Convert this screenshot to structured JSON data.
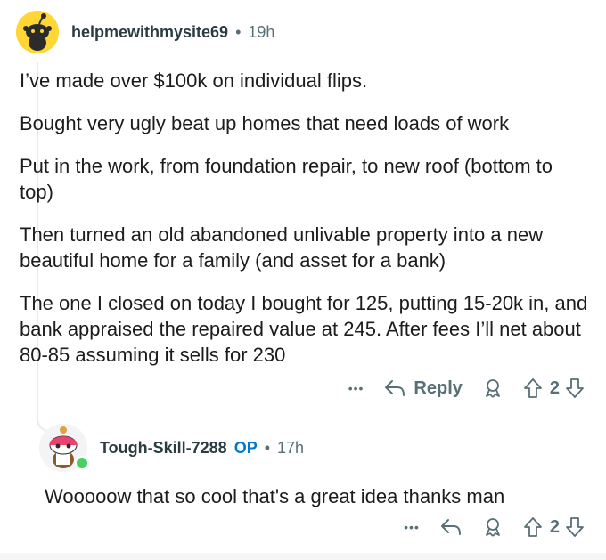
{
  "comment": {
    "username": "helpmewithmysite69",
    "separator": "•",
    "age": "19h",
    "paragraphs": [
      "I’ve made over $100k on individual flips.",
      "Bought very ugly beat up homes that need loads of work",
      "Put in the work, from foundation repair, to new roof (bottom to top)",
      "Then turned an old abandoned unlivable property into a new beautiful home for a family (and asset for a bank)",
      "The one I closed on today I bought for 125, putting 15-20k in, and bank appraised the repaired value at 245. After fees I’ll net about 80-85 assuming it sells for 230"
    ],
    "actions": {
      "more": "•••",
      "reply_label": "Reply",
      "vote_count": "2"
    }
  },
  "reply": {
    "username": "Tough-Skill-7288",
    "op_badge": "OP",
    "separator": "•",
    "age": "17h",
    "text": "Wooooow that so cool that's a great idea thanks man",
    "actions": {
      "more": "•••",
      "vote_count": "2"
    }
  },
  "colors": {
    "accent_op": "#0079d3",
    "online": "#46d160",
    "meta_gray": "#576f76"
  },
  "icons": [
    "snoo-avatar-icon",
    "reply-arrow-icon",
    "award-icon",
    "upvote-icon",
    "downvote-icon",
    "more-dots-icon"
  ]
}
